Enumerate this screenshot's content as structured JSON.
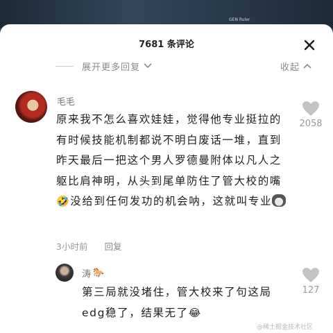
{
  "video": {
    "caption": "GEN Ruler"
  },
  "sheet": {
    "title": "7681 条评论",
    "expand_label": "展开更多回复",
    "collapse_label": "收起"
  },
  "comments": [
    {
      "username": "毛毛",
      "text": "原来我不怎么喜欢娃娃，觉得他专业挺拉的有时候技能机制都说不明白废话一堆，直到昨天最后一把这个男人罗德曼附体以凡人之躯比肩神明，从头到尾单防住了管大校的嘴",
      "text_mid": "没给到任何发功的机会呐，这就叫专业",
      "emoji_1": "laughing-crying-emoji",
      "emoji_2": "husky-emoji",
      "time": "3小时前",
      "reply_label": "回复",
      "likes": "2058"
    },
    {
      "username": "涛",
      "text": "第三局就没堵住，管大校来了句这局edg稳了，结果无了",
      "emoji": "laughing-crying-emoji",
      "likes": "127"
    }
  ],
  "watermark": "@稀土掘金技术社区",
  "colors": {
    "like_icon": "#c4c4c4",
    "text": "#1f1f1f",
    "meta": "#9a9a9a"
  }
}
